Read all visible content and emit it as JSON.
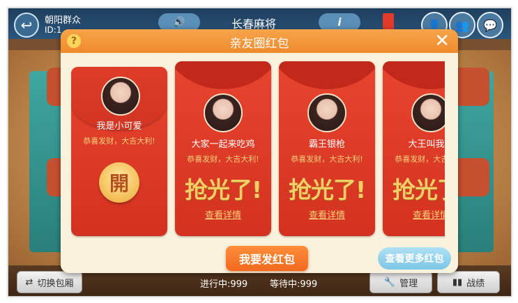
{
  "topbar": {
    "room_name": "朝阳群众",
    "room_id": "ID:1",
    "game_title": "长春麻将",
    "back_icon": "back-arrow-icon",
    "sound_icon": "speaker-icon",
    "info_icon": "info-icon"
  },
  "dialog": {
    "title": "亲友圈红包",
    "help_icon": "help-icon",
    "close_icon": "close-icon",
    "cards": [
      {
        "name": "我是小可爱",
        "wish": "恭喜发财，大吉大利!",
        "state": "unopened",
        "open_label": "開"
      },
      {
        "name": "大家一起来吃鸡",
        "wish": "恭喜发财，大吉大利!",
        "state": "grabbed",
        "status": "抢光了!",
        "link": "查看详情"
      },
      {
        "name": "霸王银枪",
        "wish": "恭喜发财，大吉大利!",
        "state": "grabbed",
        "status": "抢光了!",
        "link": "查看详情"
      },
      {
        "name": "大王叫我来",
        "wish": "恭喜发财，大吉大利!",
        "state": "grabbed",
        "status": "抢光了!",
        "link": "查看详情"
      }
    ],
    "send_button": "我要发红包",
    "more_button": "查看更多红包"
  },
  "bottombar": {
    "switch_label": "切换包厢",
    "in_progress": "进行中:999",
    "waiting": "等待中:999",
    "manage_label": "管理",
    "record_label": "战绩"
  },
  "colors": {
    "header_orange": "#f08a2b",
    "packet_red": "#d2321f",
    "gold_text": "#f2cf66",
    "more_button_blue": "#7cc6e6"
  }
}
